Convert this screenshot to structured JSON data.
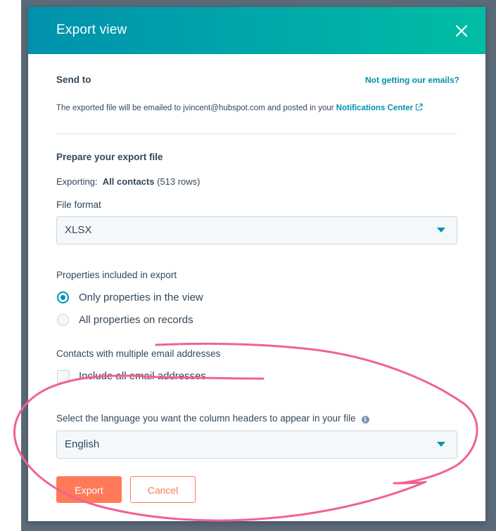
{
  "modal": {
    "title": "Export view"
  },
  "send_to": {
    "label": "Send to",
    "help_link": "Not getting our emails?",
    "info_prefix": "The exported file will be emailed to jvincent@hubspot.com and posted in your ",
    "info_link": "Notifications Center"
  },
  "prepare": {
    "label": "Prepare your export file",
    "exporting_prefix": "Exporting:",
    "exporting_value": "All contacts",
    "exporting_rows": "(513 rows)"
  },
  "file_format": {
    "label": "File format",
    "selected": "XLSX"
  },
  "properties": {
    "label": "Properties included in export",
    "options": [
      {
        "label": "Only properties in the view",
        "checked": true
      },
      {
        "label": "All properties on records",
        "checked": false
      }
    ]
  },
  "multi_email": {
    "label": "Contacts with multiple email addresses",
    "checkbox_label": "Include all email addresses",
    "checked": false
  },
  "language": {
    "label": "Select the language you want the column headers to appear in your file",
    "selected": "English"
  },
  "buttons": {
    "export": "Export",
    "cancel": "Cancel"
  },
  "colors": {
    "accent": "#0091ae",
    "header_gradient_end": "#00bda5",
    "primary_button": "#ff7a59",
    "annotation": "#f06292"
  },
  "icons": {
    "close": "close-icon",
    "external_link": "external-link-icon",
    "dropdown": "caret-down-icon",
    "info": "info-icon"
  }
}
